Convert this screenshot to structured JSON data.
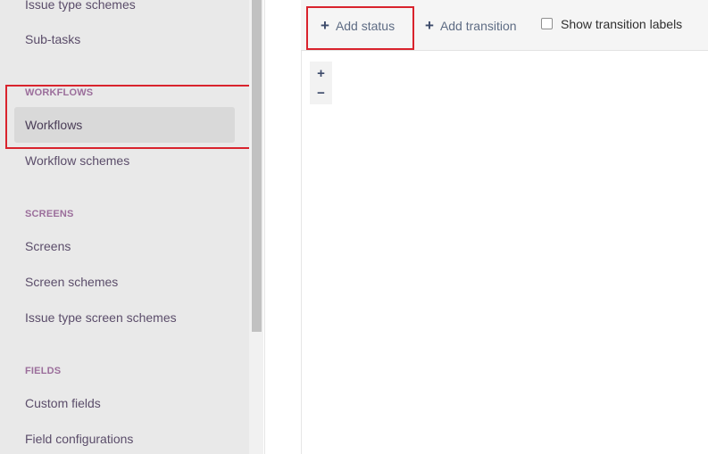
{
  "sidebar": {
    "items_top": [
      {
        "label": "Issue type schemes"
      },
      {
        "label": "Sub-tasks"
      }
    ],
    "sections": [
      {
        "heading": "WORKFLOWS",
        "items": [
          {
            "label": "Workflows",
            "active": true
          },
          {
            "label": "Workflow schemes"
          }
        ]
      },
      {
        "heading": "SCREENS",
        "items": [
          {
            "label": "Screens"
          },
          {
            "label": "Screen schemes"
          },
          {
            "label": "Issue type screen schemes"
          }
        ]
      },
      {
        "heading": "FIELDS",
        "items": [
          {
            "label": "Custom fields"
          },
          {
            "label": "Field configurations"
          }
        ]
      }
    ]
  },
  "toolbar": {
    "add_status_label": "Add status",
    "add_transition_label": "Add transition",
    "show_transition_labels": {
      "label": "Show transition labels",
      "checked": false
    }
  },
  "zoom": {
    "in_label": "+",
    "out_label": "−"
  },
  "colors": {
    "highlight": "#d9232d",
    "sidebar_bg": "#e9e9e9",
    "heading": "#9b6e9b",
    "nav_text": "#5b4d6a"
  }
}
